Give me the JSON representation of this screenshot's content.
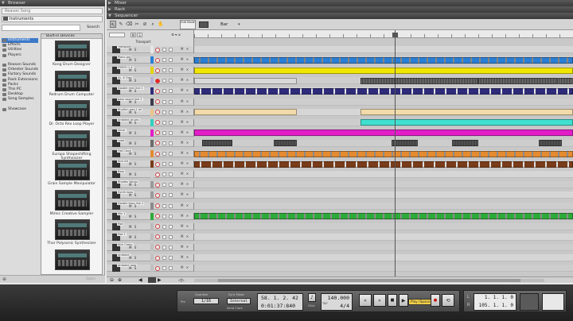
{
  "browser": {
    "title": "Browser",
    "path": "Reason Song",
    "location": "Instruments",
    "search_button": "Search",
    "categories": [
      {
        "label": "Instruments",
        "selected": true
      },
      {
        "label": "Effects",
        "selected": false
      },
      {
        "label": "Utilities",
        "selected": false
      },
      {
        "label": "Players",
        "selected": false
      },
      {
        "label": "",
        "selected": false
      },
      {
        "label": "Reason Sounds",
        "selected": false
      },
      {
        "label": "Orkester Sounds",
        "selected": false
      },
      {
        "label": "Factory Sounds",
        "selected": false
      },
      {
        "label": "Rack Extensions",
        "selected": false
      },
      {
        "label": "Packs",
        "selected": false
      },
      {
        "label": "This PC",
        "selected": false
      },
      {
        "label": "Desktop",
        "selected": false
      },
      {
        "label": "Song Samples",
        "selected": false
      },
      {
        "label": "",
        "selected": false
      },
      {
        "label": "Showcase",
        "selected": false
      }
    ],
    "devices_header": "Built-in Devices",
    "devices": [
      "Kong Drum Designer",
      "Redrum Drum Computer",
      "Dr. Octo Rex Loop Player",
      "Europa Shapeshifting Synthesizer",
      "Grain Sample Manipulator",
      "Mimic Creative Sampler",
      "Thor Polysonic Synthesizer",
      ""
    ],
    "footer_label": "Open"
  },
  "panels": {
    "mixer": "Mixer",
    "rack": "Rack",
    "sequencer": "Sequencer"
  },
  "toolbar": {
    "tools": [
      "select",
      "pencil",
      "eraser",
      "razor",
      "mute",
      "magnify",
      "hand"
    ],
    "mode_label": "Edit Mode",
    "snap_value": "Bar"
  },
  "track_header": {
    "buttons": [
      "M",
      "S",
      "Transport"
    ]
  },
  "tracks": [
    {
      "name": "Transport",
      "color": "#e8e8e8",
      "rec": false
    },
    {
      "name": "Piano gro",
      "color": "#2a7fd4",
      "rec": false
    },
    {
      "name": "SYNTH 1 X",
      "color": "#e4d200",
      "rec": false
    },
    {
      "name": "Ac. K Orgy",
      "color": "#b8b2d2",
      "rec": true
    },
    {
      "name": "Double mini line 1",
      "color": "#2e2c7a",
      "rec": false
    },
    {
      "name": "bass sound line 2",
      "color": "#3a3a4a",
      "rec": false
    },
    {
      "name": "Rhythm pad 1 all",
      "color": "#eac48a",
      "rec": false
    },
    {
      "name": "Ambient drums",
      "color": "#2ed0c0",
      "rec": false
    },
    {
      "name": "Slicer",
      "color": "#e21ec8",
      "rec": false
    },
    {
      "name": "Lead",
      "color": "#6a6a6a",
      "rec": false
    },
    {
      "name": "Hat Clock",
      "color": "#e48a30",
      "rec": false
    },
    {
      "name": "Kick Kit",
      "color": "#7a3c1a",
      "rec": false
    },
    {
      "name": "Bass",
      "color": "#cfcfcf",
      "rec": false
    },
    {
      "name": "Rhodes Voices",
      "color": "#999999",
      "rec": false
    },
    {
      "name": "Synth bass",
      "color": "#9a9a9a",
      "rec": false
    },
    {
      "name": "Double bass line 2",
      "color": "#8a8a8a",
      "rec": false
    },
    {
      "name": "Mix 1",
      "color": "#2eaa3a",
      "rec": false
    },
    {
      "name": "Pad",
      "color": "#bbbbbb",
      "rec": false
    },
    {
      "name": "Pad 2",
      "color": "#bbbbbb",
      "rec": false
    },
    {
      "name": "Kick Comp",
      "color": "#c0c0c0",
      "rec": false
    },
    {
      "name": "Ambient",
      "color": "#c0c0c0",
      "rec": false
    },
    {
      "name": "Ambient loop",
      "color": "#c0c0c0",
      "rec": false
    }
  ],
  "clips": [
    {
      "track": 1,
      "start": 0,
      "end": 100,
      "color": "#2a7fd4",
      "pattern": "notes-dark"
    },
    {
      "track": 2,
      "start": 0,
      "end": 100,
      "color": "#f0e600",
      "pattern": "plain"
    },
    {
      "track": 3,
      "start": 0,
      "end": 27,
      "color": "#d9d9d9",
      "pattern": "plain"
    },
    {
      "track": 3,
      "start": 44,
      "end": 75,
      "color": "#7a7a7a",
      "pattern": "wave"
    },
    {
      "track": 3,
      "start": 75,
      "end": 96,
      "color": "#7a7a7a",
      "pattern": "wave"
    },
    {
      "track": 3,
      "start": 96,
      "end": 100,
      "color": "#7a7a7a",
      "pattern": "wave"
    },
    {
      "track": 4,
      "start": 0,
      "end": 100,
      "color": "#2e2c7a",
      "pattern": "notes"
    },
    {
      "track": 6,
      "start": 0,
      "end": 27,
      "color": "#f1dbab",
      "pattern": "plain"
    },
    {
      "track": 6,
      "start": 44,
      "end": 100,
      "color": "#f1dbab",
      "pattern": "plain"
    },
    {
      "track": 7,
      "start": 44,
      "end": 100,
      "color": "#40e0d0",
      "pattern": "plain"
    },
    {
      "track": 8,
      "start": 0,
      "end": 100,
      "color": "#e21ec8",
      "pattern": "plain"
    },
    {
      "track": 9,
      "start": 2,
      "end": 10,
      "color": "#5a5a5a",
      "pattern": "wave"
    },
    {
      "track": 9,
      "start": 21,
      "end": 27,
      "color": "#5a5a5a",
      "pattern": "wave"
    },
    {
      "track": 9,
      "start": 52,
      "end": 59,
      "color": "#5a5a5a",
      "pattern": "wave"
    },
    {
      "track": 9,
      "start": 68,
      "end": 75,
      "color": "#5a5a5a",
      "pattern": "wave"
    },
    {
      "track": 9,
      "start": 91,
      "end": 97,
      "color": "#5a5a5a",
      "pattern": "wave"
    },
    {
      "track": 10,
      "start": 0,
      "end": 100,
      "color": "#e48a30",
      "pattern": "notes-dark"
    },
    {
      "track": 11,
      "start": 0,
      "end": 100,
      "color": "#7a3c1a",
      "pattern": "notes"
    },
    {
      "track": 16,
      "start": 0,
      "end": 100,
      "color": "#2eaa3a",
      "pattern": "notes-dark"
    }
  ],
  "ruler_ticks": 28,
  "transport": {
    "quantize_label": "Quantize",
    "quantize_value": "1/16",
    "pre_count_label": "Pre",
    "sync_label": "Sync Mode",
    "sync_value": "Internal",
    "send_clock_label": "Send Clock",
    "position_bars": "58. 1. 2. 42",
    "position_time": "0:01:37:840",
    "click_label": "Click",
    "pre_label": "Pre",
    "tempo": "140.000",
    "tempo_label": "TAP",
    "signature": "4/4",
    "play_hint": "Play (Space)",
    "loop_label": "Loop",
    "left_locator": "1. 1. 1. 0",
    "right_locator": "105. 1. 1. 0",
    "loc_l": "L",
    "loc_r": "R"
  }
}
